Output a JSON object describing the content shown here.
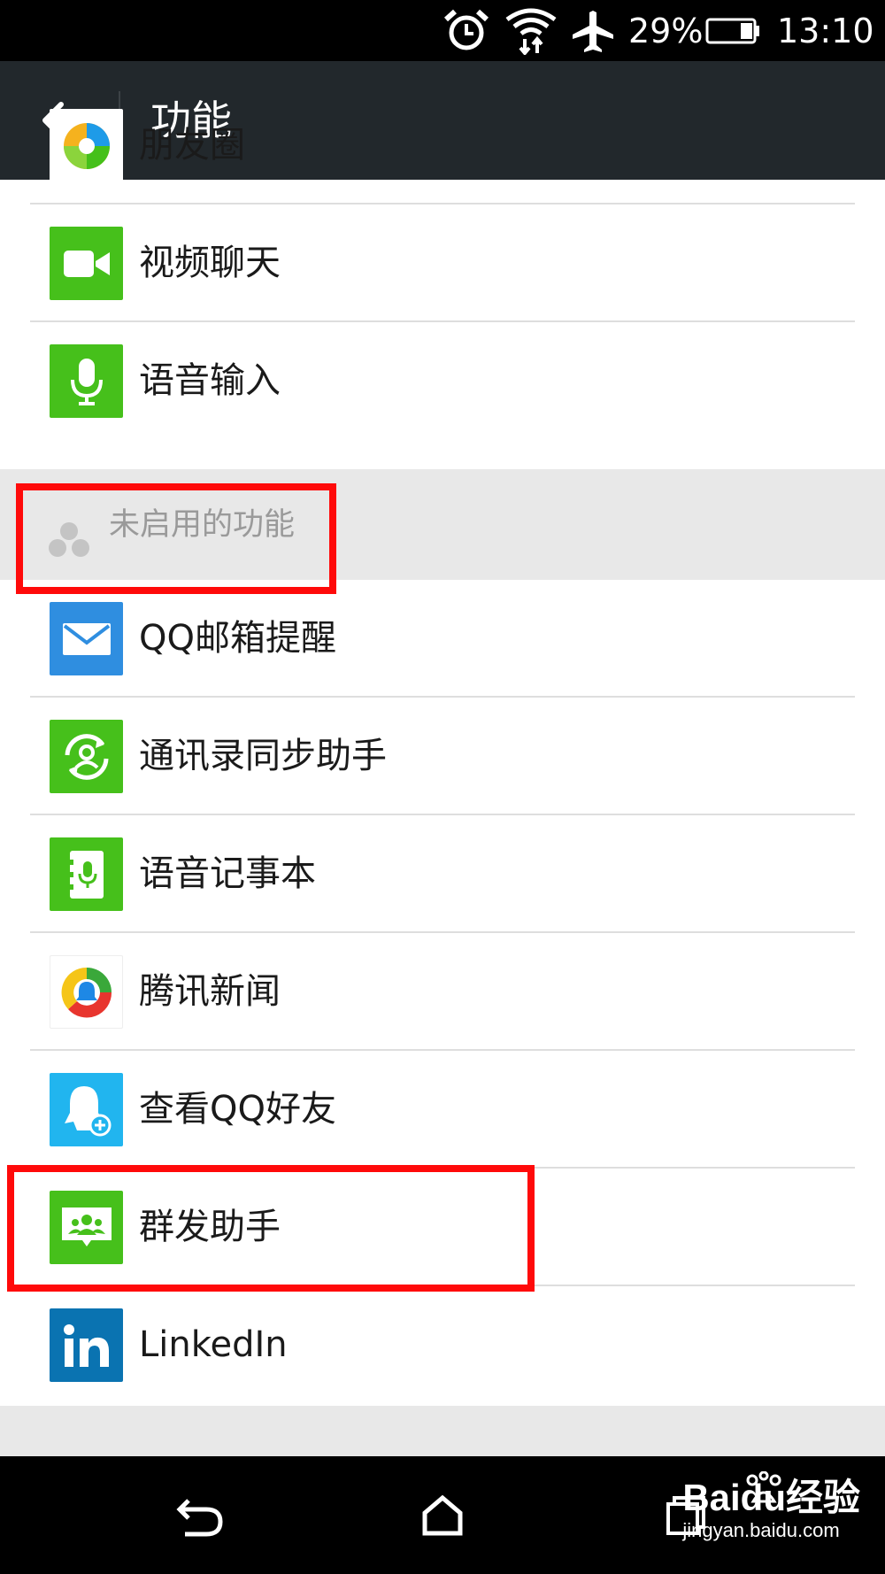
{
  "status_bar": {
    "battery": "29%",
    "time": "13:10"
  },
  "action_bar": {
    "title": "功能"
  },
  "enabled_features": [
    {
      "label": "朋友圈",
      "icon": "moments-icon"
    },
    {
      "label": "视频聊天",
      "icon": "video-camera-icon"
    },
    {
      "label": "语音输入",
      "icon": "microphone-icon"
    }
  ],
  "disabled_section": {
    "title": "未启用的功能"
  },
  "disabled_features": [
    {
      "label": "QQ邮箱提醒",
      "icon": "mail-icon"
    },
    {
      "label": "通讯录同步助手",
      "icon": "contact-sync-icon"
    },
    {
      "label": "语音记事本",
      "icon": "voice-notebook-icon"
    },
    {
      "label": "腾讯新闻",
      "icon": "tencent-news-icon"
    },
    {
      "label": "查看QQ好友",
      "icon": "qq-friend-icon"
    },
    {
      "label": "群发助手",
      "icon": "mass-message-icon"
    },
    {
      "label": "LinkedIn",
      "icon": "linkedin-icon"
    }
  ],
  "watermark": {
    "brand": "Baidu经验",
    "url": "jingyan.baidu.com"
  },
  "colors": {
    "wechat_green": "#46c01b",
    "highlight_red": "#ff0a0a",
    "action_bar": "#22282c"
  }
}
